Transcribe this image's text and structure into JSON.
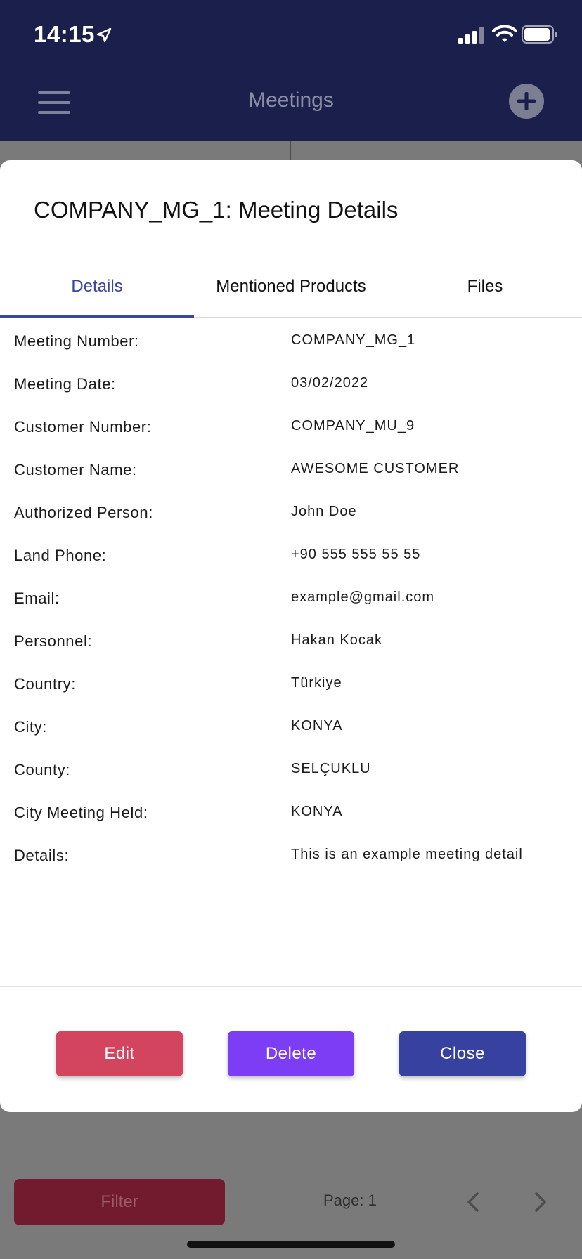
{
  "status_bar": {
    "time": "14:15"
  },
  "header": {
    "title": "Meetings"
  },
  "modal": {
    "title": "COMPANY_MG_1: Meeting Details",
    "tabs": [
      {
        "label": "Details",
        "active": true
      },
      {
        "label": "Mentioned Products",
        "active": false
      },
      {
        "label": "Files",
        "active": false
      }
    ],
    "fields": [
      {
        "label": "Meeting Number:",
        "value": "COMPANY_MG_1"
      },
      {
        "label": "Meeting Date:",
        "value": "03/02/2022"
      },
      {
        "label": "Customer Number:",
        "value": "COMPANY_MU_9"
      },
      {
        "label": "Customer Name:",
        "value": "AWESOME CUSTOMER"
      },
      {
        "label": "Authorized Person:",
        "value": "John Doe"
      },
      {
        "label": "Land Phone:",
        "value": "+90 555 555 55 55"
      },
      {
        "label": "Email:",
        "value": "example@gmail.com"
      },
      {
        "label": "Personnel:",
        "value": "Hakan Kocak"
      },
      {
        "label": "Country:",
        "value": "Türkiye"
      },
      {
        "label": "City:",
        "value": "KONYA"
      },
      {
        "label": "County:",
        "value": "SELÇUKLU"
      },
      {
        "label": "City Meeting Held:",
        "value": "KONYA"
      },
      {
        "label": "Details:",
        "value": "This is an example meeting detail"
      }
    ],
    "buttons": {
      "edit": "Edit",
      "delete": "Delete",
      "close": "Close"
    }
  },
  "footer": {
    "filter_label": "Filter",
    "page_label": "Page: 1"
  },
  "colors": {
    "header_bg": "#1b1f4b",
    "accent": "#3b46a0",
    "edit": "#d3455e",
    "delete": "#7c3df5",
    "close": "#3741a0"
  }
}
